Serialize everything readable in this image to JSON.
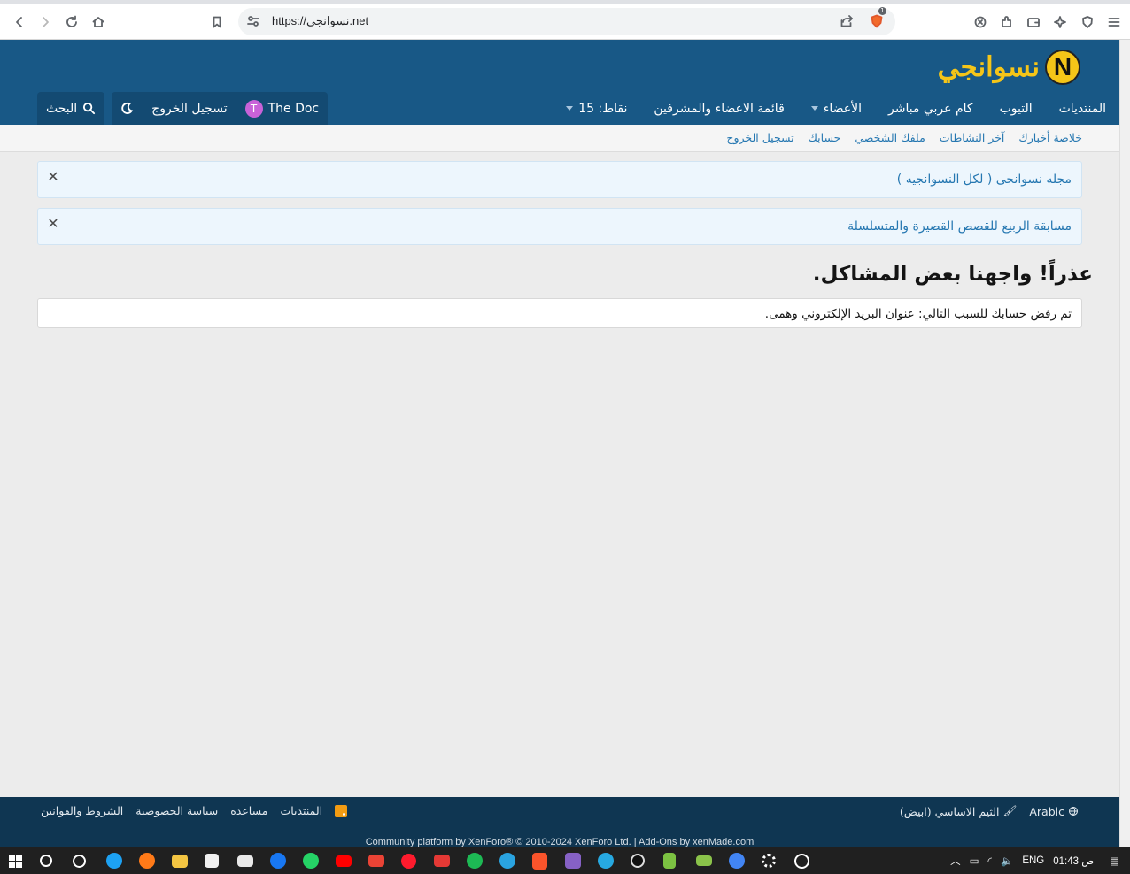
{
  "browser": {
    "url": "https://نسوانجي.net",
    "shields_count": "1"
  },
  "site": {
    "logo_text": "نسوانجي",
    "logo_letter": "N"
  },
  "nav": {
    "tabs": [
      {
        "label": "المنتديات",
        "dropdown": false
      },
      {
        "label": "التيوب",
        "dropdown": false
      },
      {
        "label": "كام عربي مباشر",
        "dropdown": false
      },
      {
        "label": "الأعضاء",
        "dropdown": true
      },
      {
        "label": "قائمة الاعضاء والمشرفين",
        "dropdown": false
      },
      {
        "label": "نقاط: 15",
        "dropdown": true
      }
    ]
  },
  "user_nav": {
    "avatar_letter": "T",
    "username": "The Doc",
    "logout_label": "تسجيل الخروج",
    "search_label": "البحث"
  },
  "subnav": {
    "links": [
      "خلاصة أخبارك",
      "آخر النشاطات",
      "ملفك الشخصي",
      "حسابك",
      "تسجيل الخروج"
    ]
  },
  "notices": [
    {
      "text": "مجله نسوانجى ( لكل النسوانجيه )"
    },
    {
      "text": "مسابقة الربيع للقصص القصيرة والمتسلسلة"
    }
  ],
  "error": {
    "title": "عذراً! واجهنا بعض المشاكل.",
    "message": "تم رفض حسابك للسبب التالي: عنوان البريد الإلكتروني وهمى."
  },
  "footer": {
    "style_label": "الثيم الاساسي (ابيض)",
    "language_label": "Arabic",
    "links": [
      "الشروط والقوانين",
      "سياسة الخصوصية",
      "مساعدة",
      "المنتديات"
    ],
    "copyright": "Community platform by XenForo® © 2010-2024 XenForo Ltd. | Add-Ons by xenMade.com"
  },
  "taskbar": {
    "language": "ENG",
    "time": "01:43 ص"
  },
  "colors": {
    "header_bg": "#185886",
    "footer_bg": "#0f3652",
    "link": "#2577b1",
    "logo": "#f5c518",
    "avatar": "#c862d8"
  }
}
